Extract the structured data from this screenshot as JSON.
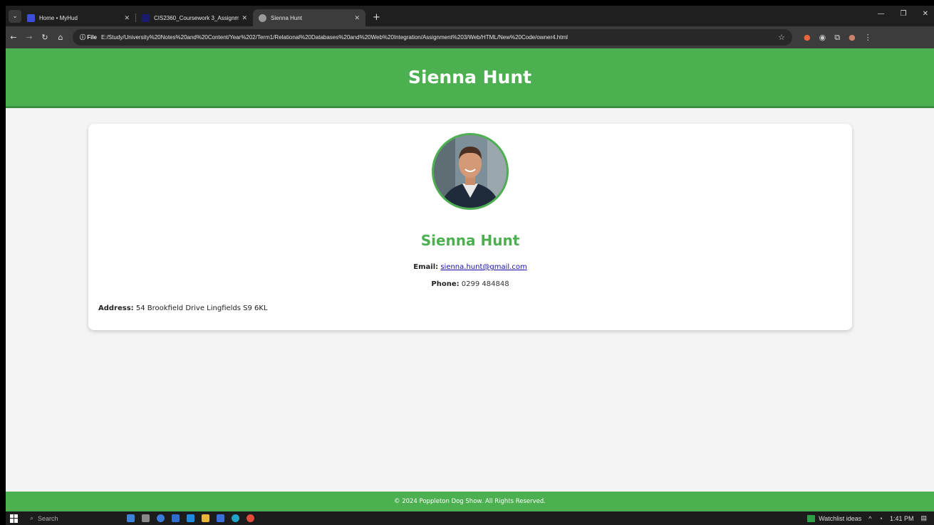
{
  "browser": {
    "tabs": [
      {
        "title": "Home • MyHud",
        "favicon_color": "#3b4fd8"
      },
      {
        "title": "CIS2360_Coursework 3_Assignme",
        "favicon_color": "#1b1b6e"
      },
      {
        "title": "Sienna Hunt",
        "favicon_color": "#9a9a9a"
      }
    ],
    "new_tab_label": "+",
    "address_chip": "ⓘ File",
    "url": "E:/Study/University%20Notes%20and%20Content/Year%202/Term1/Relational%20Databases%20and%20Web%20Integration/Assignment%203/Web/HTML/New%20Code/owner4.html"
  },
  "header": {
    "title": "Sienna Hunt"
  },
  "owner": {
    "name": "Sienna Hunt",
    "email_label": "Email:",
    "email": "sienna.hunt@gmail.com",
    "phone_label": "Phone:",
    "phone": "0299 484848",
    "address_label": "Address:",
    "address": "54 Brookfield Drive Lingfields S9 6KL"
  },
  "footer": {
    "text": "© 2024 Poppleton Dog Show. All Rights Reserved."
  },
  "taskbar": {
    "search_placeholder": "Search",
    "watchlist": "Watchlist ideas",
    "time": "1:41 PM"
  },
  "colors": {
    "brand_green": "#4caf50",
    "link": "#1a0dab"
  }
}
